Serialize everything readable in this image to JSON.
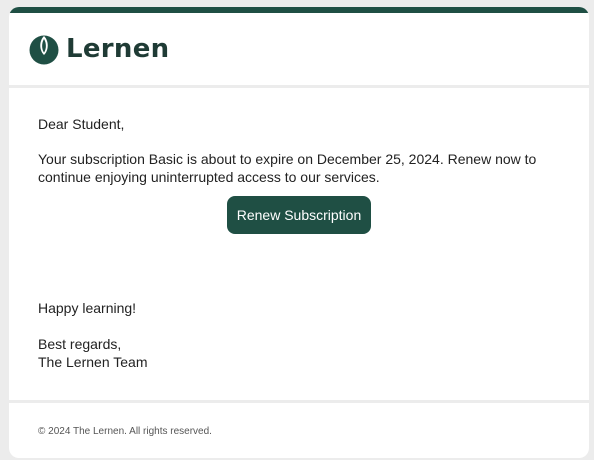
{
  "brand": {
    "name": "Lernen",
    "accent_color": "#1f4f44",
    "logo_icon": "lernen-leaf-logo-icon"
  },
  "email": {
    "greeting": "Dear Student,",
    "message": "Your subscription Basic is about to expire on December 25, 2024. Renew now to continue enjoying uninterrupted access to our services.",
    "cta_label": "Renew Subscription",
    "signoff": "Happy learning!",
    "regards": "Best regards,",
    "team": "The Lernen Team"
  },
  "footer": {
    "copyright": "© 2024 The Lernen. All rights reserved."
  }
}
